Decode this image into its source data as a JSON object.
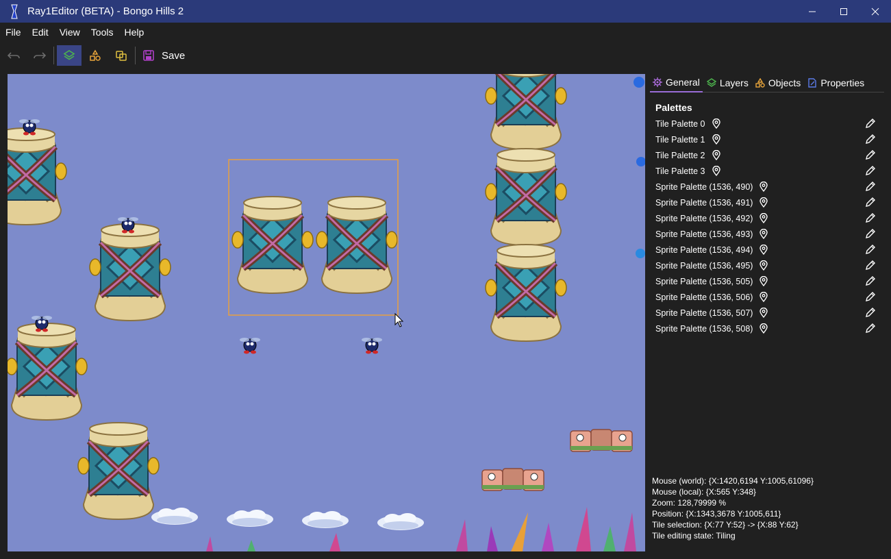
{
  "window": {
    "title": "Ray1Editor (BETA) - Bongo Hills 2"
  },
  "menu": {
    "items": [
      {
        "label": "File"
      },
      {
        "label": "Edit"
      },
      {
        "label": "View"
      },
      {
        "label": "Tools"
      },
      {
        "label": "Help"
      }
    ]
  },
  "toolbar": {
    "save_label": "Save",
    "icons": [
      "undo-icon",
      "redo-icon",
      "layers-icon",
      "objects-icon",
      "links-icon",
      "save-icon"
    ]
  },
  "panel": {
    "tabs": [
      {
        "label": "General",
        "icon": "gear-icon",
        "color": "#a86ad8",
        "active": true
      },
      {
        "label": "Layers",
        "icon": "layers-icon",
        "color": "#4db34d",
        "active": false
      },
      {
        "label": "Objects",
        "icon": "objects-icon",
        "color": "#e8a43a",
        "active": false
      },
      {
        "label": "Properties",
        "icon": "properties-icon",
        "color": "#5b7ae8",
        "active": false
      }
    ],
    "section_title": "Palettes",
    "palettes": [
      "Tile Palette 0",
      "Tile Palette 1",
      "Tile Palette 2",
      "Tile Palette 3",
      "Sprite Palette (1536, 490)",
      "Sprite Palette (1536, 491)",
      "Sprite Palette (1536, 492)",
      "Sprite Palette (1536, 493)",
      "Sprite Palette (1536, 494)",
      "Sprite Palette (1536, 495)",
      "Sprite Palette (1536, 505)",
      "Sprite Palette (1536, 506)",
      "Sprite Palette (1536, 507)",
      "Sprite Palette (1536, 508)"
    ]
  },
  "info": {
    "mouse_world": "Mouse (world): {X:1420,6194 Y:1005,61096}",
    "mouse_local": "Mouse (local): {X:565 Y:348}",
    "zoom": "Zoom: 128,79999 %",
    "position": "Position: {X:1343,3678 Y:1005,611}",
    "tile_selection": "Tile selection: {X:77 Y:52} -> {X:88 Y:62}",
    "tile_state": "Tile editing state: Tiling"
  },
  "colors": {
    "titlebar": "#2b3a7a",
    "background": "#202020",
    "canvas": "#7d8bcb",
    "active_tool": "#3a4586",
    "selection": "#e8a040"
  }
}
